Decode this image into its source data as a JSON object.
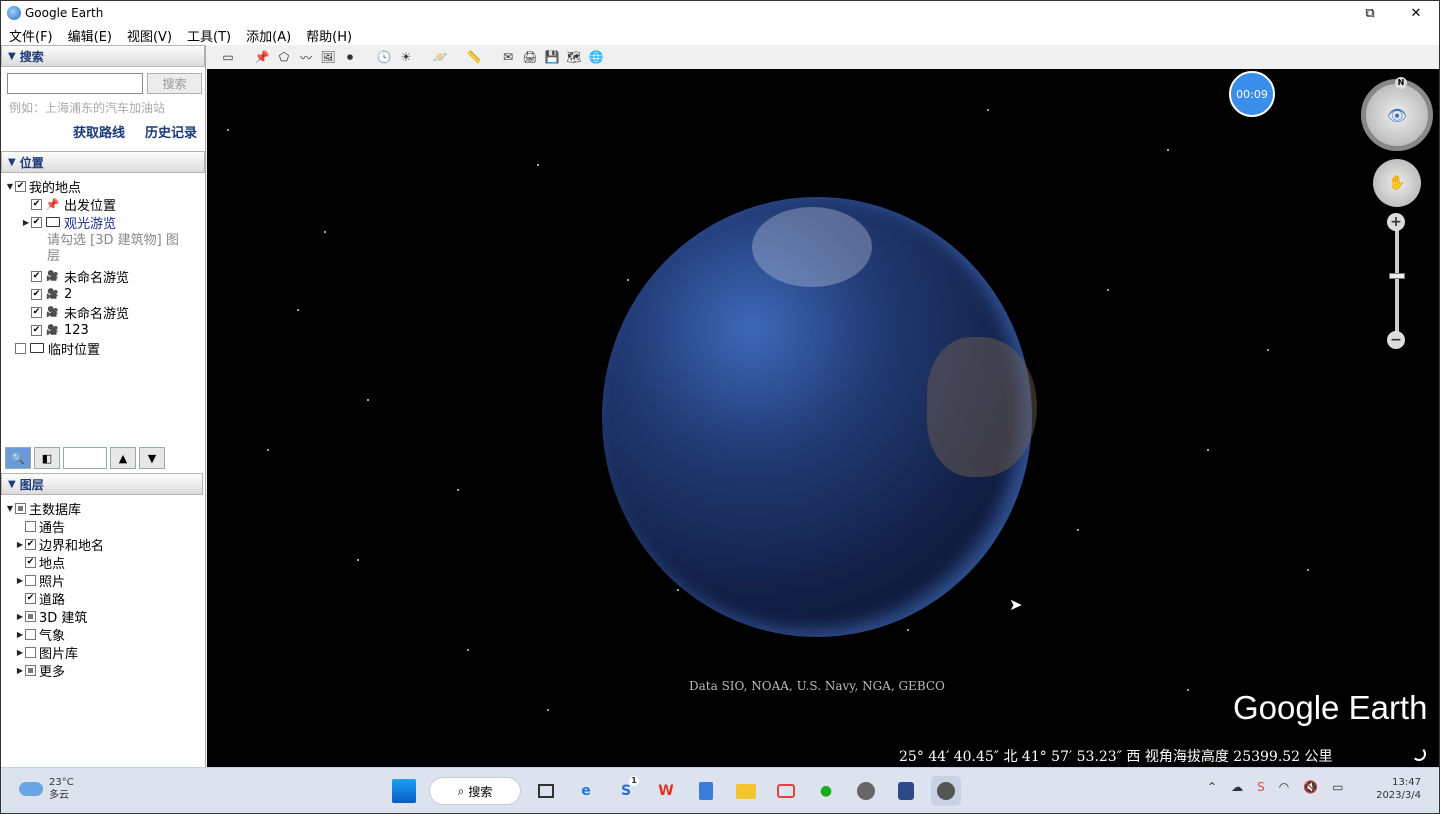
{
  "window": {
    "title": "Google Earth",
    "restore_glyph": "⧉",
    "close_glyph": "✕"
  },
  "menu": [
    "文件(F)",
    "编辑(E)",
    "视图(V)",
    "工具(T)",
    "添加(A)",
    "帮助(H)"
  ],
  "search_panel": {
    "header": "搜索",
    "input_value": "",
    "button": "搜索",
    "hint": "例如：上海浦东的汽车加油站",
    "links": [
      "获取路线",
      "历史记录"
    ]
  },
  "places_panel": {
    "header": "位置",
    "items": [
      {
        "label": "我的地点",
        "checked": true,
        "expand": "▼",
        "level": 0,
        "icon": "none"
      },
      {
        "label": "出发位置",
        "checked": true,
        "level": 1,
        "icon": "pushpin-icon"
      },
      {
        "label": "观光游览",
        "checked": true,
        "expand": "▶",
        "level": 1,
        "icon": "folder-icon",
        "style": "blue-bold"
      },
      {
        "label": "请勾选 [3D 建筑物] 图层",
        "level": 2,
        "style": "gray-text"
      },
      {
        "label": "未命名游览",
        "checked": true,
        "level": 1,
        "icon": "tour-icon"
      },
      {
        "label": "2",
        "checked": true,
        "level": 1,
        "icon": "tour-icon"
      },
      {
        "label": "未命名游览",
        "checked": true,
        "level": 1,
        "icon": "tour-icon"
      },
      {
        "label": "123",
        "checked": true,
        "level": 1,
        "icon": "tour-icon"
      },
      {
        "label": "临时位置",
        "checked": false,
        "level": 0,
        "icon": "folder-icon"
      }
    ]
  },
  "mid_toolbar": {
    "up_glyph": "▲",
    "down_glyph": "▼"
  },
  "layers_panel": {
    "header": "图层",
    "items": [
      {
        "label": "主数据库",
        "state": "partial",
        "expand": "▼",
        "level": 0
      },
      {
        "label": "通告",
        "state": "unchecked",
        "level": 1
      },
      {
        "label": "边界和地名",
        "state": "checked",
        "expand": "▶",
        "level": 1
      },
      {
        "label": "地点",
        "state": "checked",
        "level": 1
      },
      {
        "label": "照片",
        "state": "unchecked",
        "expand": "▶",
        "level": 1
      },
      {
        "label": "道路",
        "state": "checked",
        "level": 1
      },
      {
        "label": "3D 建筑",
        "state": "partial",
        "expand": "▶",
        "level": 1
      },
      {
        "label": "气象",
        "state": "unchecked",
        "expand": "▶",
        "level": 1
      },
      {
        "label": "图片库",
        "state": "unchecked",
        "expand": "▶",
        "level": 1
      },
      {
        "label": "更多",
        "state": "partial",
        "expand": "▶",
        "level": 1
      }
    ]
  },
  "toolbar_icons": [
    "sidebar-toggle-icon",
    "placemark-icon",
    "polygon-icon",
    "path-icon",
    "image-overlay-icon",
    "record-tour-icon",
    "historical-imagery-icon",
    "sunlight-icon",
    "planets-icon",
    "ruler-icon",
    "email-icon",
    "print-icon",
    "save-image-icon",
    "view-in-maps-icon",
    "earth-icon"
  ],
  "map": {
    "timer": "00:09",
    "compass_n": "N",
    "attribution": "Data SIO, NOAA, U.S. Navy, NGA, GEBCO",
    "brand": "Google Earth",
    "status": "25° 44′ 40.45″ 北   41° 57′ 53.23″ 西  视角海拔高度 25399.52 公里"
  },
  "taskbar": {
    "weather_temp": "23°C",
    "weather_desc": "多云",
    "search_label": "搜索",
    "notification_badge": "1",
    "time": "13:47",
    "date": "2023/3/4"
  }
}
